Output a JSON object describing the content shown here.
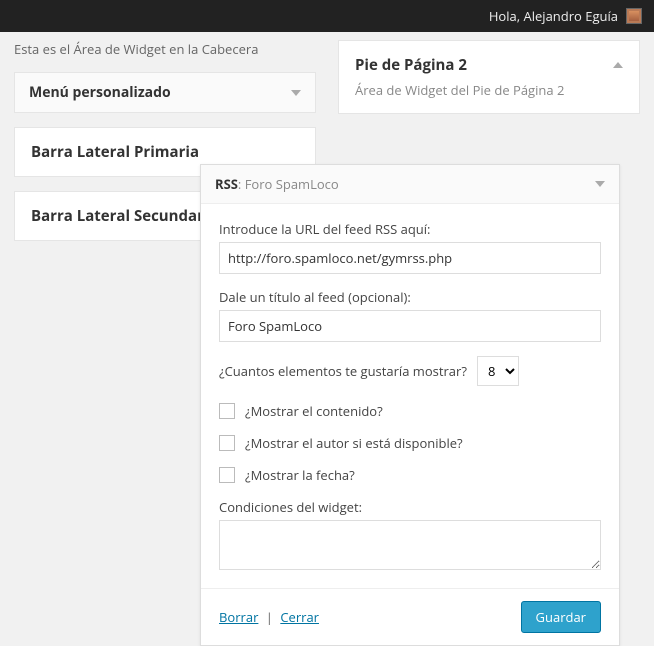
{
  "adminbar": {
    "greeting": "Hola, Alejandro Eguía"
  },
  "left": {
    "area_desc": "Esta es el Área de Widget en la Cabecera",
    "widget_menu": "Menú personalizado",
    "area_primary": "Barra Lateral Primaria",
    "area_secondary": "Barra Lateral Secundaria"
  },
  "right": {
    "footer2_title": "Pie de Página 2",
    "footer2_desc": "Área de Widget del Pie de Página 2"
  },
  "modal": {
    "title_prefix": "RSS",
    "title_name": ": Foro SpamLoco",
    "url_label": "Introduce la URL del feed RSS aquí:",
    "url_value": "http://foro.spamloco.net/gymrss.php",
    "title_label": "Dale un título al feed (opcional):",
    "title_value": "Foro SpamLoco",
    "count_label": "¿Cuantos elementos te gustaría mostrar?",
    "count_value": "8",
    "show_content": "¿Mostrar el contenido?",
    "show_author": "¿Mostrar el autor si está disponible?",
    "show_date": "¿Mostrar la fecha?",
    "conditions_label": "Condiciones del widget:",
    "delete": "Borrar",
    "close": "Cerrar",
    "save": "Guardar"
  }
}
